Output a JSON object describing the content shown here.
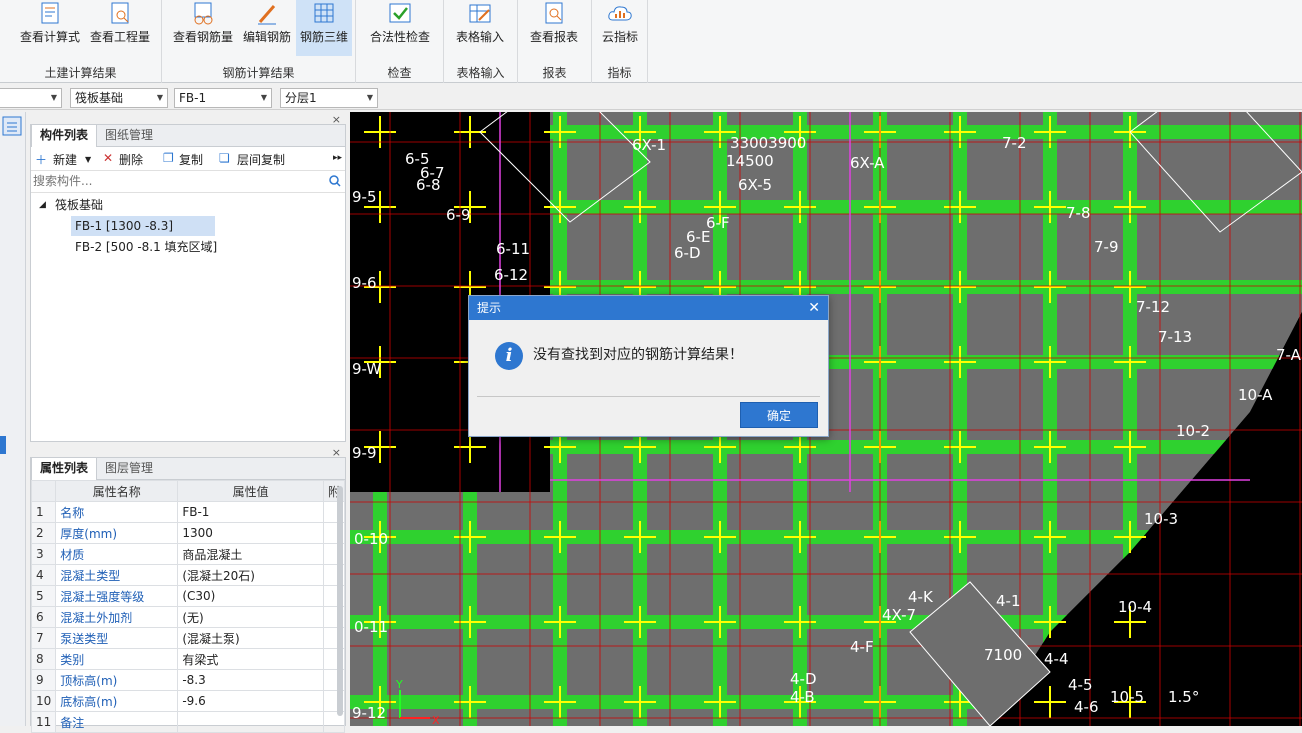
{
  "ribbon": {
    "groups": [
      {
        "name": "土建计算结果",
        "buttons": [
          "查看计算式",
          "查看工程量"
        ]
      },
      {
        "name": "钢筋计算结果",
        "buttons": [
          "查看钢筋量",
          "编辑钢筋",
          "钢筋三维"
        ]
      },
      {
        "name": "检查",
        "buttons": [
          "合法性检查"
        ]
      },
      {
        "name": "表格输入",
        "buttons": [
          "表格输入"
        ]
      },
      {
        "name": "报表",
        "buttons": [
          "查看报表"
        ]
      },
      {
        "name": "指标",
        "buttons": [
          "云指标"
        ]
      }
    ]
  },
  "selectors": {
    "type": "筏板基础",
    "item": "FB-1",
    "layer": "分层1"
  },
  "component_panel": {
    "tabs": [
      "构件列表",
      "图纸管理"
    ],
    "toolbar": {
      "new": "新建",
      "delete": "删除",
      "copy": "复制",
      "floor_copy": "层间复制"
    },
    "search_placeholder": "搜索构件...",
    "tree_root": "筏板基础",
    "items": [
      "FB-1 [1300 -8.3]",
      "FB-2 [500 -8.1 填充区域]"
    ]
  },
  "property_panel": {
    "tabs": [
      "属性列表",
      "图层管理"
    ],
    "header": {
      "name": "属性名称",
      "value": "属性值",
      "extra": "附"
    },
    "rows": [
      {
        "n": "1",
        "k": "名称",
        "v": "FB-1"
      },
      {
        "n": "2",
        "k": "厚度(mm)",
        "v": "1300"
      },
      {
        "n": "3",
        "k": "材质",
        "v": "商品混凝土"
      },
      {
        "n": "4",
        "k": "混凝土类型",
        "v": "(混凝土20石)"
      },
      {
        "n": "5",
        "k": "混凝土强度等级",
        "v": "(C30)"
      },
      {
        "n": "6",
        "k": "混凝土外加剂",
        "v": "(无)"
      },
      {
        "n": "7",
        "k": "泵送类型",
        "v": "(混凝土泵)"
      },
      {
        "n": "8",
        "k": "类别",
        "v": "有梁式"
      },
      {
        "n": "9",
        "k": "顶标高(m)",
        "v": "-8.3"
      },
      {
        "n": "10",
        "k": "底标高(m)",
        "v": "-9.6"
      },
      {
        "n": "11",
        "k": "备注",
        "v": ""
      }
    ]
  },
  "cad_labels": [
    "6X-1",
    "6X-A",
    "6X-5",
    "6-5",
    "6-7",
    "6-8",
    "6-9",
    "6-11",
    "6-12",
    "6-D",
    "6-E",
    "6-F",
    "7-2",
    "7-8",
    "7-9",
    "7-12",
    "7-13",
    "7-A",
    "10-A",
    "10-2",
    "10-3",
    "10-4",
    "10-5",
    "4-K",
    "4-1",
    "4-4",
    "4-5",
    "4-6",
    "4-D",
    "4-B",
    "4-F",
    "4X-7",
    "9-5",
    "9-6",
    "9-W",
    "9-9",
    "0-10",
    "0-11",
    "9-12",
    "7100",
    "14500",
    "33003900",
    "1.5°"
  ],
  "dialog": {
    "title": "提示",
    "message": "没有查找到对应的钢筋计算结果！",
    "ok": "确定"
  },
  "colors": {
    "accent": "#2e77d0",
    "beam": "#2fd12f",
    "slab": "#6e6e6e",
    "rebar": "#ffff00",
    "axis": "#d10000",
    "magenta": "#e040e0"
  }
}
